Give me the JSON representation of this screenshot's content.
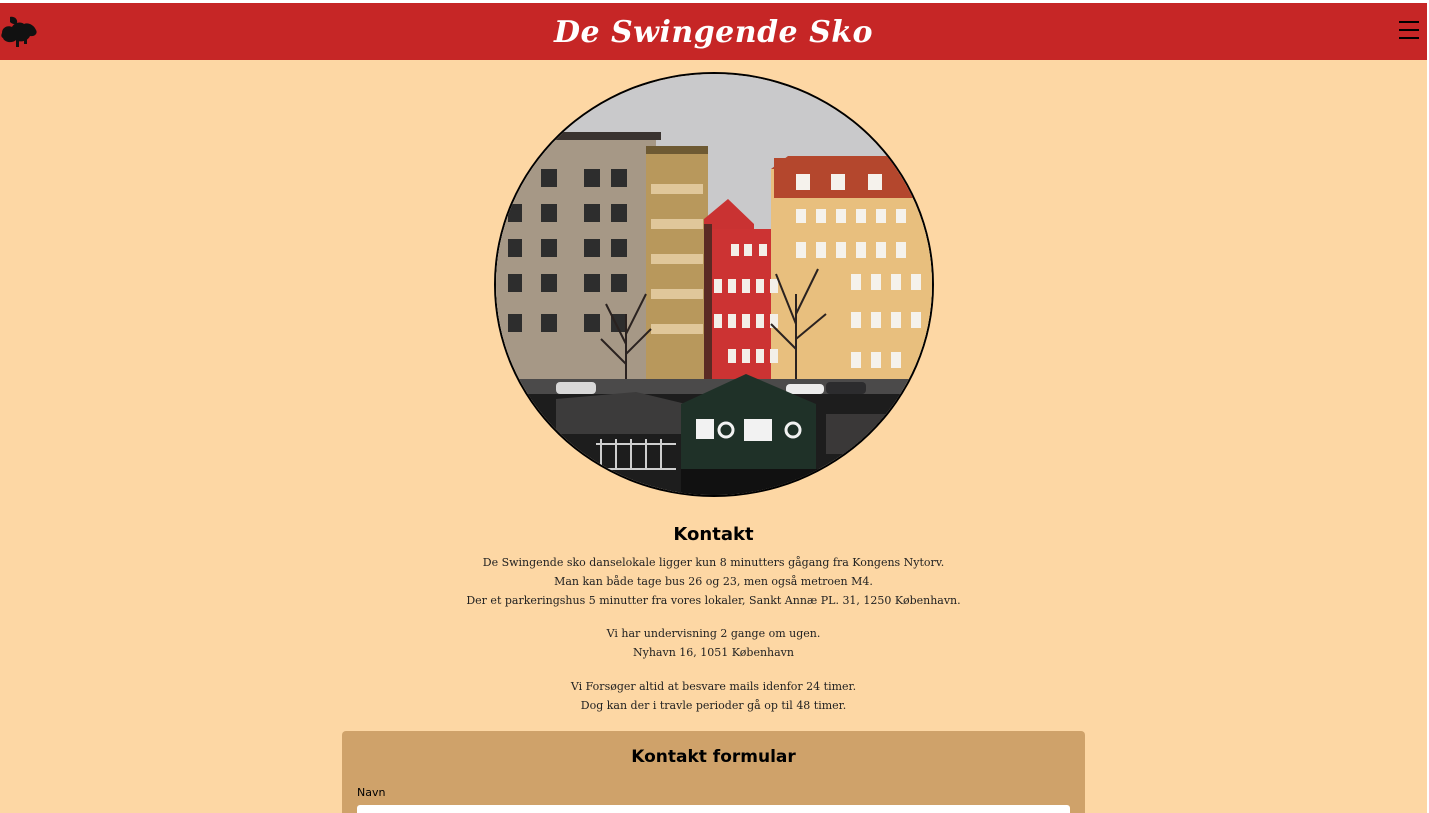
{
  "header": {
    "title": "De Swingende Sko",
    "logo_icon": "dancing-shoes-logo-icon",
    "menu_icon": "hamburger-menu-icon",
    "background": "#c62626"
  },
  "hero": {
    "image": "nyhavn-houses-photo"
  },
  "contact": {
    "title": "Kontakt",
    "lines_1": [
      "De Swingende sko danselokale ligger kun 8 minutters gågang fra Kongens Nytorv.",
      "Man kan både tage bus 26 og 23, men også metroen M4.",
      "Der et parkeringshus 5 minutter fra vores lokaler, Sankt Annæ PL. 31, 1250 København."
    ],
    "lines_2": [
      "Vi har undervisning 2 gange om ugen.",
      "Nyhavn 16, 1051 København"
    ],
    "lines_3": [
      "Vi Forsøger altid at besvare mails idenfor 24 timer.",
      "Dog kan der i travle perioder gå op til 48 timer."
    ]
  },
  "form": {
    "title": "Kontakt formular",
    "name_label": "Navn",
    "name_value": ""
  },
  "colors": {
    "page_background": "#fdd7a4",
    "form_background": "#cfa26a"
  }
}
